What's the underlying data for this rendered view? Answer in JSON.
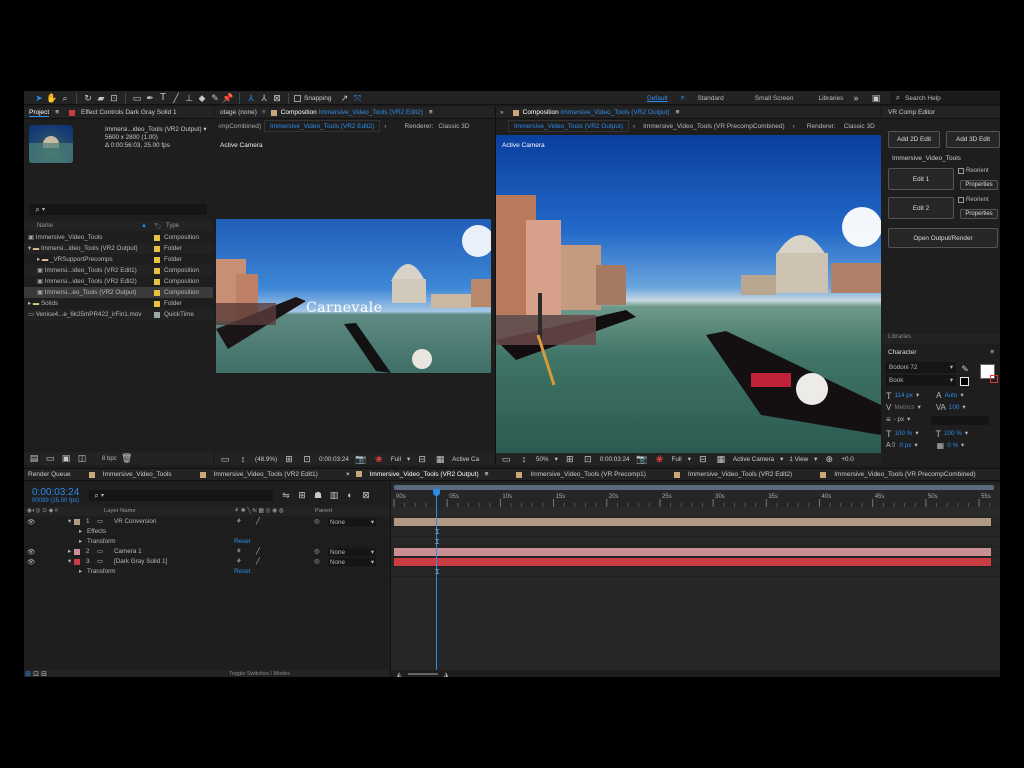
{
  "toolbar": {
    "snapping_label": "Snapping",
    "workspaces": [
      "Default",
      "Standard",
      "Small Screen",
      "Libraries"
    ],
    "active_workspace": "Default",
    "search_placeholder": "Search Help"
  },
  "left_panel": {
    "tab_project": "Project",
    "tab_effect_controls": "Effect Controls Dark Gray Solid 1",
    "thumb_name": "Immersi...ideo_Tools (VR2 Output)",
    "thumb_size": "5600 x 2800 (1.00)",
    "thumb_duration": "Δ 0:00:56:03, 25.00 fps",
    "col_name": "Name",
    "col_type": "Type",
    "items": [
      {
        "name": "Immersive_Video_Tools",
        "type": "Composition",
        "indent": 0,
        "color": "sw-yel"
      },
      {
        "name": "Immersi...ideo_Tools (VR2 Output)",
        "type": "Folder",
        "indent": 0,
        "color": "sw-yel"
      },
      {
        "name": "_VRSupportPrecomps",
        "type": "Folder",
        "indent": 1,
        "color": "sw-yel"
      },
      {
        "name": "Immersi...ideo_Tools (VR2 Edit1)",
        "type": "Composition",
        "indent": 1,
        "color": "sw-yel"
      },
      {
        "name": "Immersi...ideo_Tools (VR2 Edit2)",
        "type": "Composition",
        "indent": 1,
        "color": "sw-yel"
      },
      {
        "name": "Immersi...eo_Tools (VR2 Output)",
        "type": "Composition",
        "indent": 1,
        "color": "sw-yel"
      },
      {
        "name": "Solids",
        "type": "Folder",
        "indent": 0,
        "color": "sw-yel"
      },
      {
        "name": "Venice4...e_6k25mPR422_irFin1.mov",
        "type": "QuickTime",
        "indent": 0,
        "color": "sw-gray"
      }
    ],
    "bpc": "8 bpc"
  },
  "viewer1": {
    "header_left": "otage (none)",
    "header_comp_prefix": "Composition",
    "header_comp_name": "Immersive_Video_Tools (VR2 Edit2)",
    "subtab_prev": "‹mpCombined)",
    "subtab_active": "Immersive_Video_Tools (VR2 Edit2)",
    "renderer": "Renderer:",
    "renderer_value": "Classic 3D",
    "camera_label": "Active Camera",
    "overlay_title": "Carnevale",
    "zoom": "(48.9%)",
    "timecode": "0:00:03:24",
    "resolution": "Full",
    "view": "Active Ca"
  },
  "viewer2": {
    "header_comp_prefix": "Composition",
    "header_comp_name": "Immersive_Video_Tools (VR2 Output)",
    "subtab_active": "Immersive_Video_Tools (VR2 Output)",
    "subtab_other": "Immersive_Video_Tools (VR PrecompCombined)",
    "renderer": "Renderer:",
    "renderer_value": "Classic 3D",
    "camera_label": "Active Camera",
    "zoom": "50%",
    "timecode": "0:00:03:24",
    "resolution": "Full",
    "view": "Active Camera",
    "views": "1 View",
    "offset": "+0.0"
  },
  "vr_panel": {
    "title": "VR Comp Editor",
    "add2d": "Add 2D Edit",
    "add3d": "Add 3D Edit",
    "comp_name": "Immersive_Video_Tools",
    "edit1": "Edit 1",
    "edit2": "Edit 2",
    "reorient": "Reorient",
    "properties": "Properties",
    "open_output": "Open Output/Render",
    "libraries": "Libraries"
  },
  "character": {
    "title": "Character",
    "font": "Bodoni 72",
    "style": "Book",
    "size": "114 px",
    "leading": "Auto",
    "kerning": "Metrics",
    "tracking": "100",
    "stroke": "- px",
    "vscale": "100 %",
    "hscale": "100 %",
    "baseline": "0 px",
    "tsume": "0 %"
  },
  "timeline": {
    "tabs": [
      "Render Queue",
      "Immersive_Video_Tools",
      "Immersive_Video_Tools (VR2 Edit1)",
      "Immersive_Video_Tools (VR2 Output)",
      "Immersive_Video_Tools (VR Precomp1)",
      "Immersive_Video_Tools (VR2 Edit2)",
      "Immersive_Video_Tools (VR PrecompCombined)"
    ],
    "active_tab": "Immersive_Video_Tools (VR2 Output)",
    "timecode": "0:00:03:24",
    "frames": "00099 (25.00 fps)",
    "col_layer_name": "Layer Name",
    "col_parent": "Parent",
    "ticks": [
      "00s",
      "05s",
      "10s",
      "15s",
      "20s",
      "25s",
      "30s",
      "35s",
      "40s",
      "45s",
      "50s",
      "55s"
    ],
    "playhead_seconds": 3.96,
    "duration_seconds": 56.12,
    "layers": [
      {
        "num": "1",
        "name": "VR Conversion",
        "parent": "None",
        "color": "#b09a84",
        "sub": [
          "Effects",
          "Transform"
        ]
      },
      {
        "num": "2",
        "name": "Camera 1",
        "parent": "None",
        "color": "#c98f95",
        "sub": []
      },
      {
        "num": "3",
        "name": "[Dark Gray Solid 1]",
        "parent": "None",
        "color": "#c93c44",
        "sub": [
          "Transform"
        ]
      }
    ],
    "reset_label": "Reset",
    "footer_label": "Toggle Switches / Modes"
  }
}
